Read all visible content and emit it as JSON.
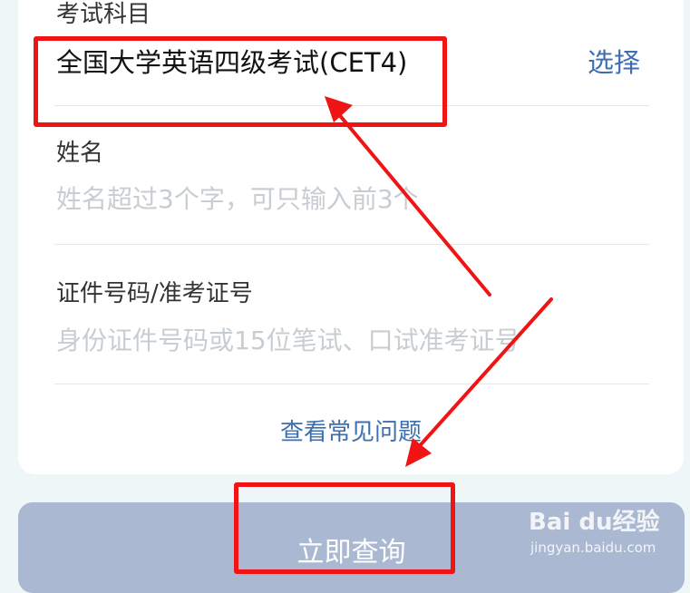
{
  "form": {
    "subject": {
      "label": "考试科目",
      "value": "全国大学英语四级考试(CET4)",
      "action": "选择"
    },
    "name": {
      "label": "姓名",
      "placeholder": "姓名超过3个字，可只输入前3个"
    },
    "id_number": {
      "label": "证件号码/准考证号",
      "placeholder": "身份证件号码或15位笔试、口试准考证号"
    },
    "faq_link": "查看常见问题"
  },
  "submit": {
    "label": "立即查询"
  },
  "watermark": {
    "brand": "Bai du经验",
    "url": "jingyan.baidu.com"
  },
  "colors": {
    "link": "#3d6fb0",
    "button": "#aab9d1",
    "annotation": "#f01414",
    "placeholder": "#c8cdd1",
    "background": "#eef6f7"
  }
}
